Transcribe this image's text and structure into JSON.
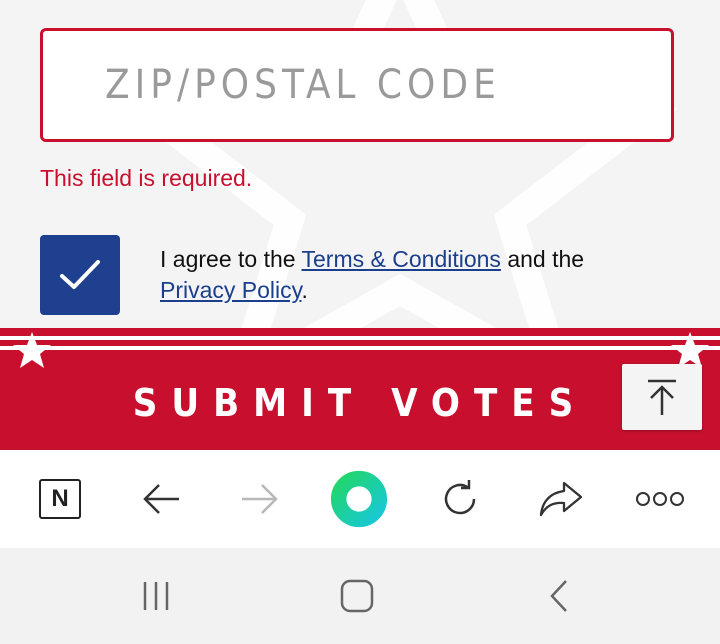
{
  "form": {
    "zip_placeholder": "ZIP/POSTAL CODE",
    "zip_value": "",
    "error_text": "This field is required.",
    "agree_checked": true,
    "agree_prefix": "I agree to the ",
    "terms_link": "Terms & Conditions",
    "agree_middle": " and the",
    "privacy_link": "Privacy Policy",
    "agree_suffix": "."
  },
  "submit": {
    "label": "SUBMIT VOTES"
  },
  "colors": {
    "accent_red": "#c8102e",
    "checkbox_blue": "#1f3f8f",
    "link_blue": "#1a3f8c"
  },
  "browser_toolbar": {
    "items": [
      "naver-icon",
      "back-arrow-icon",
      "forward-arrow-icon",
      "home-ring-icon",
      "refresh-icon",
      "share-icon",
      "more-dots-icon"
    ],
    "naver_letter": "N"
  },
  "system_nav": {
    "items": [
      "recent-apps-icon",
      "home-icon",
      "back-icon"
    ]
  }
}
